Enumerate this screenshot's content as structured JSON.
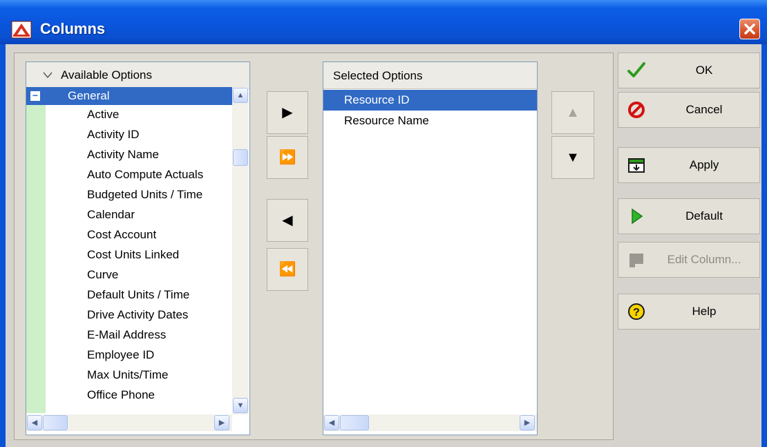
{
  "window": {
    "title": "Columns",
    "close_label": "✕"
  },
  "available": {
    "header": "Available Options",
    "group": {
      "expander": "−",
      "label": "General"
    },
    "items": [
      "Active",
      "Activity ID",
      "Activity Name",
      "Auto Compute Actuals",
      "Budgeted Units / Time",
      "Calendar",
      "Cost Account",
      "Cost Units Linked",
      "Curve",
      "Default Units / Time",
      "Drive Activity Dates",
      "E-Mail Address",
      "Employee ID",
      "Max Units/Time",
      "Office Phone"
    ]
  },
  "selected": {
    "header": "Selected Options",
    "items": [
      "Resource ID",
      "Resource Name"
    ],
    "selected_index": 0
  },
  "move_buttons": {
    "add": "▶",
    "add_all": "⏩",
    "remove": "◀",
    "remove_all": "⏪",
    "move_up": "▲",
    "move_down": "▼"
  },
  "actions": {
    "ok": "OK",
    "cancel": "Cancel",
    "apply": "Apply",
    "default": "Default",
    "edit_column": "Edit Column...",
    "help": "Help"
  },
  "colors": {
    "selection": "#316ac5",
    "title_bar": "#0a55dc",
    "group_stripe": "#cdf0c8"
  }
}
